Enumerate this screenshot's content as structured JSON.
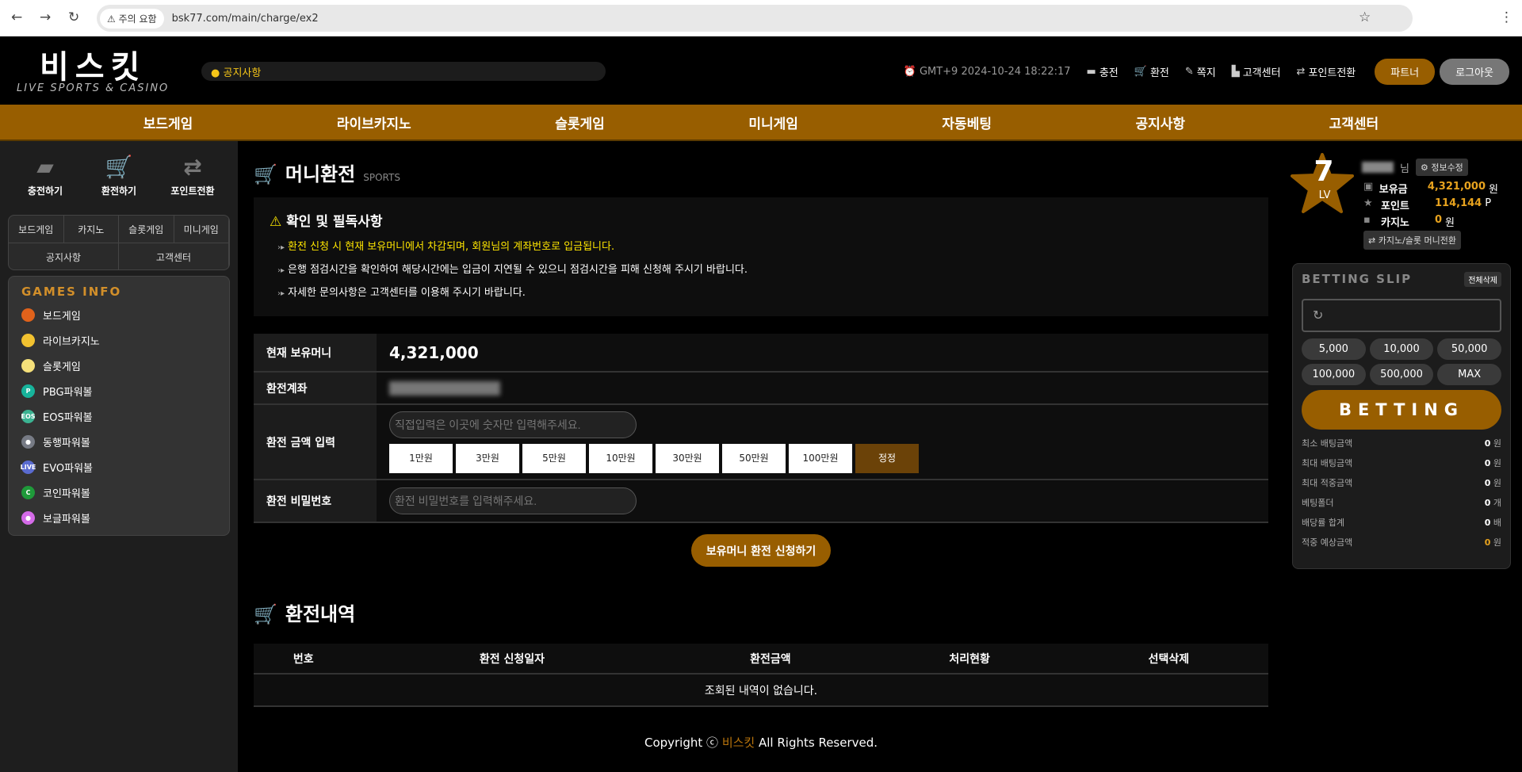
{
  "browser": {
    "back": "←",
    "forward": "→",
    "reload": "↻",
    "warning": "⚠ 주의 요함",
    "url": "bsk77.com/main/charge/ex2",
    "star": "☆",
    "menu": "⋮"
  },
  "header": {
    "logo": "비스킷",
    "logo_sub": "LIVE SPORTS & CASINO",
    "notice": "공지사항",
    "clock": "GMT+9 2024-10-24 18:22:17",
    "links": [
      {
        "icon": "wallet-icon",
        "glyph": "▬",
        "label": "충전"
      },
      {
        "icon": "cart-icon",
        "glyph": "🛒",
        "label": "환전"
      },
      {
        "icon": "note-icon",
        "glyph": "✎",
        "label": "쪽지"
      },
      {
        "icon": "chat-icon",
        "glyph": "▙",
        "label": "고객센터"
      },
      {
        "icon": "exchange-icon",
        "glyph": "⇄",
        "label": "포인트전환"
      }
    ],
    "partner": "파트너",
    "logout": "로그아웃"
  },
  "nav": [
    "보드게임",
    "라이브카지노",
    "슬롯게임",
    "미니게임",
    "자동베팅",
    "공지사항",
    "고객센터"
  ],
  "sidebar": {
    "quick": [
      {
        "glyph": "▰",
        "label": "충전하기"
      },
      {
        "glyph": "🛒",
        "label": "환전하기"
      },
      {
        "glyph": "⇄",
        "label": "포인트전환"
      }
    ],
    "tabs": [
      "보드게임",
      "카지노",
      "슬롯게임",
      "미니게임",
      "공지사항",
      "고객센터"
    ],
    "games_title": "GAMES INFO",
    "games": [
      {
        "label": "보드게임",
        "color": "#e0621b",
        "mark": ""
      },
      {
        "label": "라이브카지노",
        "color": "#f2c230",
        "mark": ""
      },
      {
        "label": "슬롯게임",
        "color": "#f5e07a",
        "mark": ""
      },
      {
        "label": "PBG파워볼",
        "color": "#17b39b",
        "mark": "P"
      },
      {
        "label": "EOS파워볼",
        "color": "#3bb392",
        "mark": "EOS"
      },
      {
        "label": "동행파워볼",
        "color": "#777b85",
        "mark": "●"
      },
      {
        "label": "EVO파워볼",
        "color": "#5a6bd0",
        "mark": "LIVE"
      },
      {
        "label": "코인파워볼",
        "color": "#1f9a3a",
        "mark": "C"
      },
      {
        "label": "보글파워볼",
        "color": "#d46be8",
        "mark": "●"
      }
    ]
  },
  "main": {
    "title": "머니환전",
    "title_sub": "SPORTS",
    "notice_title": "확인 및 필독사항",
    "notices": [
      "환전 신청 시 현재 보유머니에서 차감되며, 회원님의 계좌번호로 입금됩니다.",
      "은행 점검시간을 확인하여 해당시간에는 입금이 지연될 수 있으니 점검시간을 피해 신청해 주시기 바랍니다.",
      "자세한 문의사항은 고객센터를 이용해 주시기 바랍니다."
    ],
    "balance_label": "현재 보유머니",
    "balance": "4,321,000",
    "account_label": "환전계좌",
    "amount_label": "환전 금액 입력",
    "amount_placeholder": "직접입력은 이곳에 숫자만 입력해주세요.",
    "amount_buttons": [
      "1만원",
      "3만원",
      "5만원",
      "10만원",
      "30만원",
      "50만원",
      "100만원"
    ],
    "reset": "정정",
    "password_label": "환전 비밀번호",
    "password_placeholder": "환전 비밀번호를 입력해주세요.",
    "submit": "보유머니 환전 신청하기",
    "history_title": "환전내역",
    "history_cols": [
      "번호",
      "환전 신청일자",
      "환전금액",
      "처리현황",
      "선택삭제"
    ],
    "history_empty": "조회된 내역이 없습니다.",
    "copyright_pre": "Copyright ⓒ",
    "copyright_brand": "비스킷",
    "copyright_post": "All Rights Reserved."
  },
  "user": {
    "level": "7",
    "lv": "LV",
    "suffix": "님",
    "edit": "⚙ 정보수정",
    "wallet": [
      {
        "label": "보유금",
        "value": "4,321,000",
        "unit": "원"
      },
      {
        "label": "포인트",
        "value": "114,144",
        "unit": "P"
      },
      {
        "label": "카지노",
        "value": "0",
        "unit": "원"
      }
    ],
    "convert": "⇄ 카지노/슬롯 머니전환"
  },
  "slip": {
    "title": "BETTING SLIP",
    "clear": "전체삭제",
    "chips": [
      "5,000",
      "10,000",
      "50,000",
      "100,000",
      "500,000",
      "MAX"
    ],
    "bet": "BETTING",
    "rows": [
      {
        "label": "최소 배팅금액",
        "value": "0",
        "unit": "원"
      },
      {
        "label": "최대 배팅금액",
        "value": "0",
        "unit": "원"
      },
      {
        "label": "최대 적중금액",
        "value": "0",
        "unit": "원"
      },
      {
        "label": "베팅폴더",
        "value": "0",
        "unit": "개"
      },
      {
        "label": "배당률 합계",
        "value": "0",
        "unit": "배"
      },
      {
        "label": "적중 예상금액",
        "value": "0",
        "unit": "원"
      }
    ]
  }
}
